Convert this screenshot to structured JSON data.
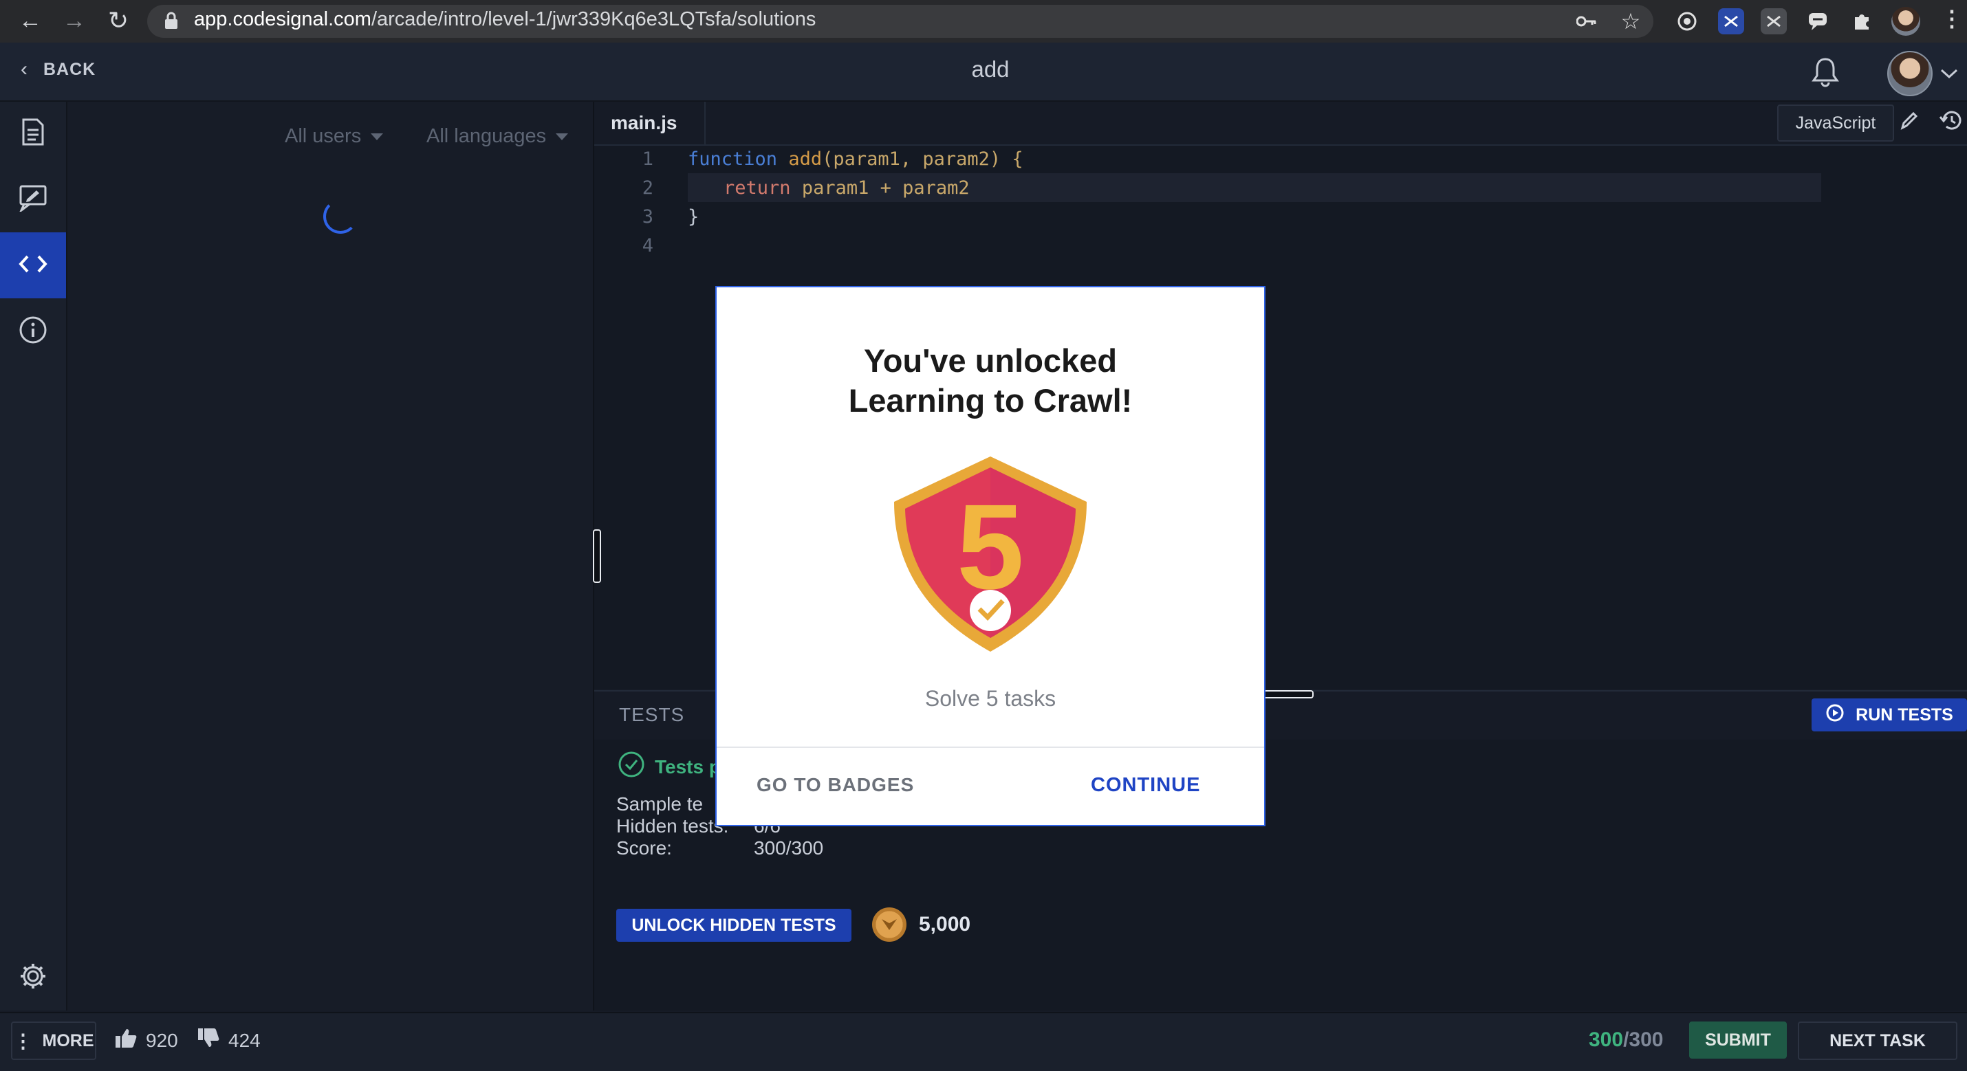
{
  "browser": {
    "url_host": "app.codesignal.com",
    "url_path": "/arcade/intro/level-1/jwr339Kq6e3LQTsfa/solutions"
  },
  "header": {
    "back_label": "BACK",
    "title": "add"
  },
  "solutions": {
    "filter_users": "All users",
    "filter_languages": "All languages"
  },
  "editor": {
    "file_name": "main.js",
    "language": "JavaScript",
    "lines": [
      {
        "num": "1",
        "kw": "function",
        "fn": "add",
        "params": "(param1, param2) {"
      },
      {
        "num": "2",
        "ret": "return",
        "expr": "param1 + param2"
      },
      {
        "num": "3",
        "text": "}"
      },
      {
        "num": "4",
        "text": ""
      }
    ]
  },
  "tests": {
    "label": "TESTS",
    "run_label": "RUN TESTS",
    "status": "Tests p",
    "sample_label": "Sample te",
    "hidden_label": "Hidden tests:",
    "hidden_value": "6/6",
    "score_label": "Score:",
    "score_value": "300/300",
    "unlock_label": "UNLOCK HIDDEN TESTS",
    "coins": "5,000"
  },
  "footer": {
    "more_label": "MORE",
    "likes": "920",
    "dislikes": "424",
    "score_current": "300",
    "score_total": "/300",
    "submit_label": "SUBMIT",
    "next_label": "NEXT TASK"
  },
  "modal": {
    "title_line1": "You've unlocked",
    "title_line2": "Learning to Crawl!",
    "badge_number": "5",
    "subtitle": "Solve 5 tasks",
    "go_to_badges": "GO TO BADGES",
    "continue": "CONTINUE"
  },
  "colors": {
    "accent_blue": "#1d3fae",
    "success_green": "#3fb37f",
    "badge_red": "#e03a58",
    "badge_gold": "#e8a838"
  }
}
